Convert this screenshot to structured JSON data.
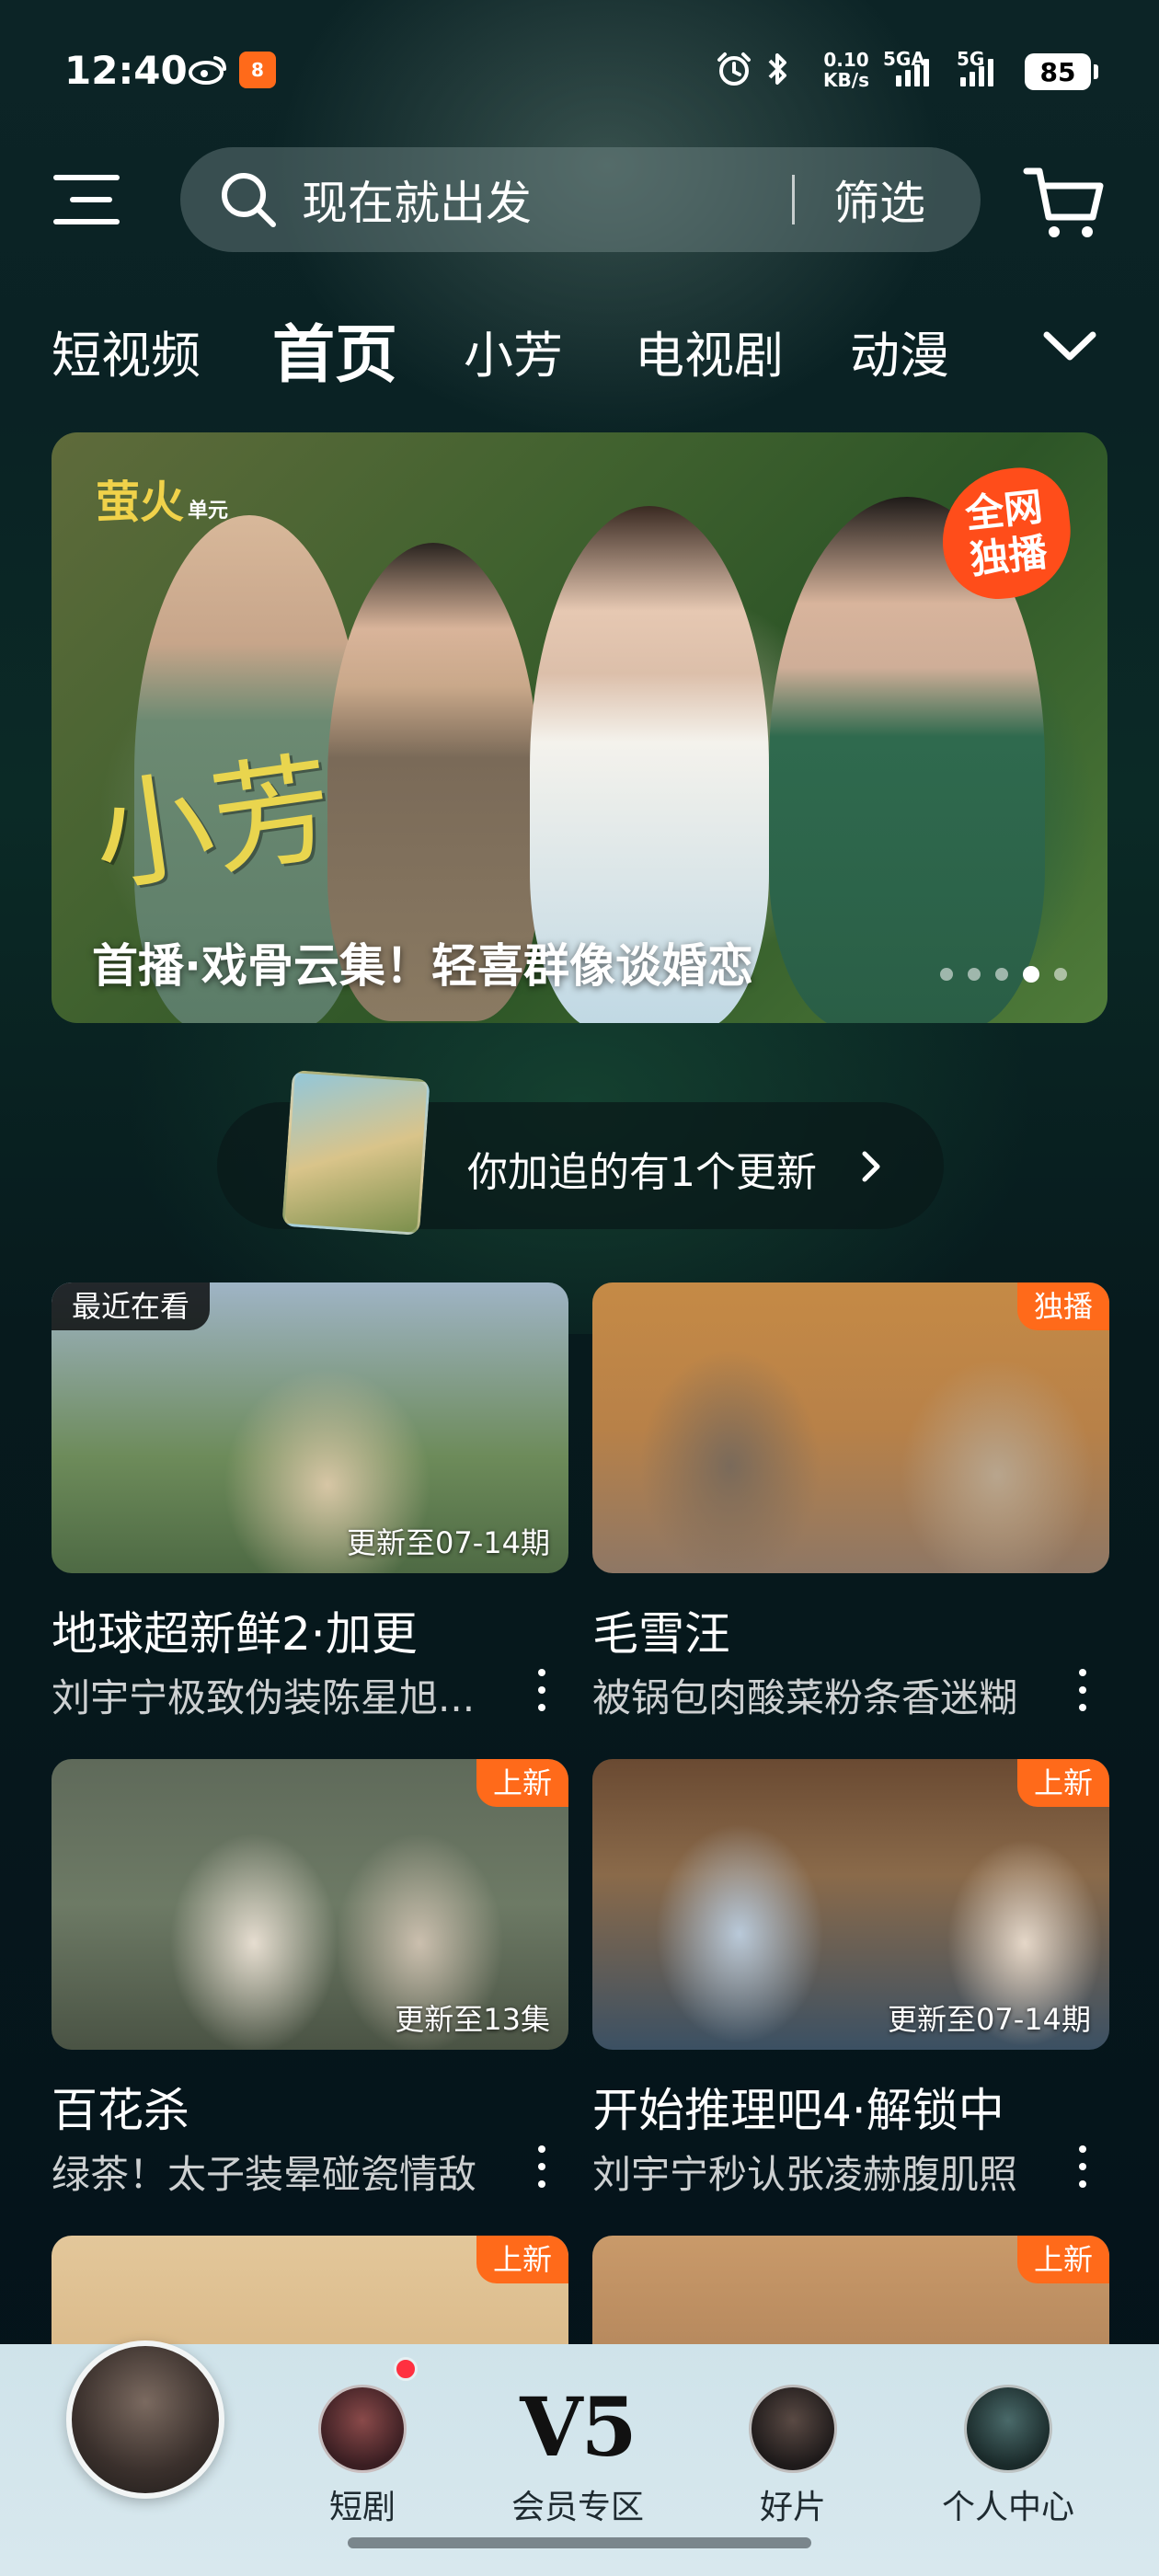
{
  "status_bar": {
    "time": "12:40",
    "app_badge": "8",
    "net_speed_value": "0.10",
    "net_speed_unit": "KB/s",
    "net_1": "5GA",
    "net_2": "5G",
    "battery": "85"
  },
  "header": {
    "search_text": "现在就出发",
    "filter_label": "筛选"
  },
  "nav_tabs": [
    {
      "label": "短视频"
    },
    {
      "label": "首页",
      "active": true
    },
    {
      "label": "小芳"
    },
    {
      "label": "电视剧"
    },
    {
      "label": "动漫"
    }
  ],
  "banner": {
    "logo": "萤火",
    "logo_suffix": "单元",
    "title_art": "小芳",
    "badge_line1": "全网",
    "badge_line2": "独播",
    "caption": "首播·戏骨云集！轻喜群像谈婚恋",
    "dots_count": 5,
    "active_dot": 3
  },
  "follow_update": {
    "text": "你加追的有1个更新"
  },
  "cards": [
    {
      "title": "地球超新鲜2·加更",
      "subtitle": "刘宇宁极致伪装陈星旭...",
      "tag_left": "最近在看",
      "tag_right": "",
      "update": "更新至07-14期"
    },
    {
      "title": "毛雪汪",
      "subtitle": "被锅包肉酸菜粉条香迷糊",
      "tag_left": "",
      "tag_right": "独播",
      "update": ""
    },
    {
      "title": "百花杀",
      "subtitle": "绿茶！太子装晕碰瓷情敌",
      "tag_left": "",
      "tag_right": "上新",
      "update": "更新至13集"
    },
    {
      "title": "开始推理吧4·解锁中",
      "subtitle": "刘宇宁秒认张凌赫腹肌照",
      "tag_left": "",
      "tag_right": "上新",
      "update": "更新至07-14期"
    },
    {
      "title": "",
      "subtitle": "",
      "tag_left": "",
      "tag_right": "上新",
      "update": ""
    },
    {
      "title": "",
      "subtitle": "",
      "tag_left": "",
      "tag_right": "上新",
      "update": ""
    }
  ],
  "bottom_nav": {
    "items": [
      {
        "label": "短剧"
      },
      {
        "label": "会员专区",
        "badge": "V5"
      },
      {
        "label": "好片"
      },
      {
        "label": "个人中心"
      }
    ]
  },
  "colors": {
    "accent": "#ff6a1a",
    "background": "#071a1d",
    "bottom_nav": "#d2e5ec"
  }
}
